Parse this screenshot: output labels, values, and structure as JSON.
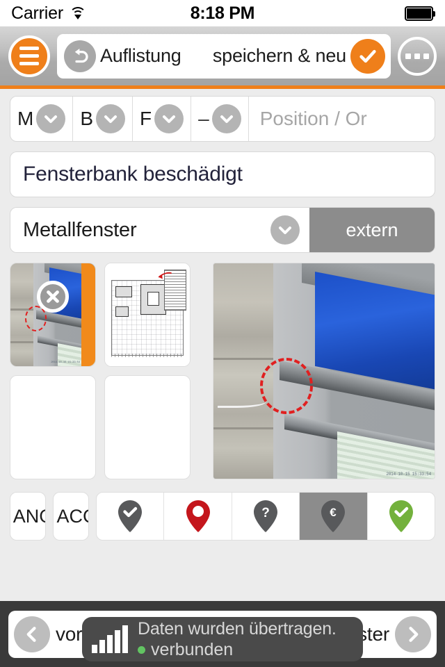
{
  "statusbar": {
    "carrier": "Carrier",
    "time": "8:18 PM",
    "wifi_icon": "wifi-icon",
    "battery_icon": "battery-full-icon"
  },
  "toolbar": {
    "menu_icon": "hamburger-menu-icon",
    "undo_icon": "undo-arrow-icon",
    "back_label": "Auflistung",
    "save_label": "speichern & neu",
    "save_icon": "check-circle-icon",
    "more_icon": "more-options-icon"
  },
  "segments": [
    {
      "label": "M",
      "icon": "chevron-down-icon"
    },
    {
      "label": "B",
      "icon": "chevron-down-icon"
    },
    {
      "label": "F",
      "icon": "chevron-down-icon"
    },
    {
      "label": "–",
      "icon": "chevron-down-icon"
    }
  ],
  "position_field": {
    "placeholder": "Position / Or",
    "value": ""
  },
  "title_field": {
    "value": "Fensterbank beschädigt",
    "placeholder": ""
  },
  "category_select": {
    "value": "Metallfenster",
    "icon": "chevron-down-icon"
  },
  "extern_button": {
    "label": "extern"
  },
  "media": {
    "thumbnails": [
      {
        "type": "photo",
        "selected": true,
        "delete_icon": "close-circle-icon",
        "timestamp": "2014-10-15 15:33:54"
      },
      {
        "type": "floorplan",
        "selected": false
      },
      {
        "type": "empty",
        "selected": false
      },
      {
        "type": "empty",
        "selected": false
      }
    ],
    "preview": {
      "type": "photo",
      "timestamp": "2014-10-15 15:33:54"
    }
  },
  "mini_buttons": [
    {
      "label": "ANG"
    },
    {
      "label": "ACC"
    }
  ],
  "pins": [
    {
      "icon": "pin-check-gray-icon",
      "color": "#58595b",
      "active": false,
      "glyph": "check"
    },
    {
      "icon": "pin-open-red-icon",
      "color": "#c4161c",
      "active": false,
      "glyph": "hollow"
    },
    {
      "icon": "pin-question-gray-icon",
      "color": "#58595b",
      "active": false,
      "glyph": "question"
    },
    {
      "icon": "pin-euro-gray-icon",
      "color": "#58595b",
      "active": true,
      "glyph": "euro"
    },
    {
      "icon": "pin-check-green-icon",
      "color": "#73b13c",
      "active": false,
      "glyph": "check"
    }
  ],
  "bottom_nav": {
    "prev_label": "voriges",
    "prev_icon": "chevron-left-circle-icon",
    "next_label": "nächstes Fenster",
    "next_icon": "chevron-right-circle-icon"
  },
  "toast": {
    "signal_icon": "signal-bars-icon",
    "line1": "Daten wurden übertragen.",
    "line2": "verbunden",
    "status_dot_color": "#62c462"
  },
  "colors": {
    "accent": "#ef7f1a",
    "toolbar_gray": "#b4b4b4",
    "extern_gray": "#8c8c8c",
    "bottom_dark": "#3a3a3a"
  }
}
